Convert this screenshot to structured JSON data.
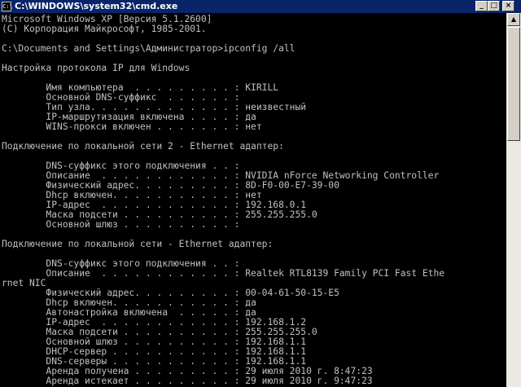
{
  "window": {
    "title": "C:\\WINDOWS\\system32\\cmd.exe",
    "icon_label": "C:\\",
    "icons": {
      "app": "cmd-icon",
      "minimize": "minimize-icon",
      "maximize": "maximize-icon",
      "close": "close-icon",
      "scroll_up": "arrow-up-icon"
    },
    "controls": {
      "minimize": "_",
      "maximize": "□",
      "close": "×",
      "scroll_up": "▲"
    }
  },
  "console": {
    "lines": [
      "Microsoft Windows XP [Версия 5.1.2600]",
      "(С) Корпорация Майкрософт, 1985-2001.",
      "",
      "C:\\Documents and Settings\\Администратор>ipconfig /all",
      "",
      "Настройка протокола IP для Windows",
      "",
      "        Имя компьютера  . . . . . . . . . : KIRILL",
      "        Основной DNS-суффикс  . . . . . . :",
      "        Тип узла. . . . . . . . . . . . . : неизвестный",
      "        IP-маршрутизация включена . . . . : да",
      "        WINS-прокси включен . . . . . . . : нет",
      "",
      "Подключение по локальной сети 2 - Ethernet адаптер:",
      "",
      "        DNS-суффикс этого подключения . . :",
      "        Описание  . . . . . . . . . . . . : NVIDIA nForce Networking Controller",
      "        Физический адрес. . . . . . . . . : 8D-F0-00-E7-39-00",
      "        Dhcp включен. . . . . . . . . . . : нет",
      "        IP-адрес  . . . . . . . . . . . . : 192.168.0.1",
      "        Маска подсети . . . . . . . . . . : 255.255.255.0",
      "        Основной шлюз . . . . . . . . . . :",
      "",
      "Подключение по локальной сети - Ethernet адаптер:",
      "",
      "        DNS-суффикс этого подключения . . :",
      "        Описание  . . . . . . . . . . . . : Realtek RTL8139 Family PCI Fast Ethe",
      "rnet NIC",
      "        Физический адрес. . . . . . . . . : 00-04-61-50-15-E5",
      "        Dhcp включен. . . . . . . . . . . : да",
      "        Автонастройка включена  . . . . . : да",
      "        IP-адрес  . . . . . . . . . . . . : 192.168.1.2",
      "        Маска подсети . . . . . . . . . . : 255.255.255.0",
      "        Основной шлюз . . . . . . . . . . : 192.168.1.1",
      "        DHCP-сервер . . . . . . . . . . . : 192.168.1.1",
      "        DNS-серверы . . . . . . . . . . . : 192.168.1.1",
      "        Аренда получена . . . . . . . . . : 29 июля 2010 г. 8:47:23",
      "        Аренда истекает . . . . . . . . . : 29 июля 2010 г. 9:47:23"
    ]
  }
}
